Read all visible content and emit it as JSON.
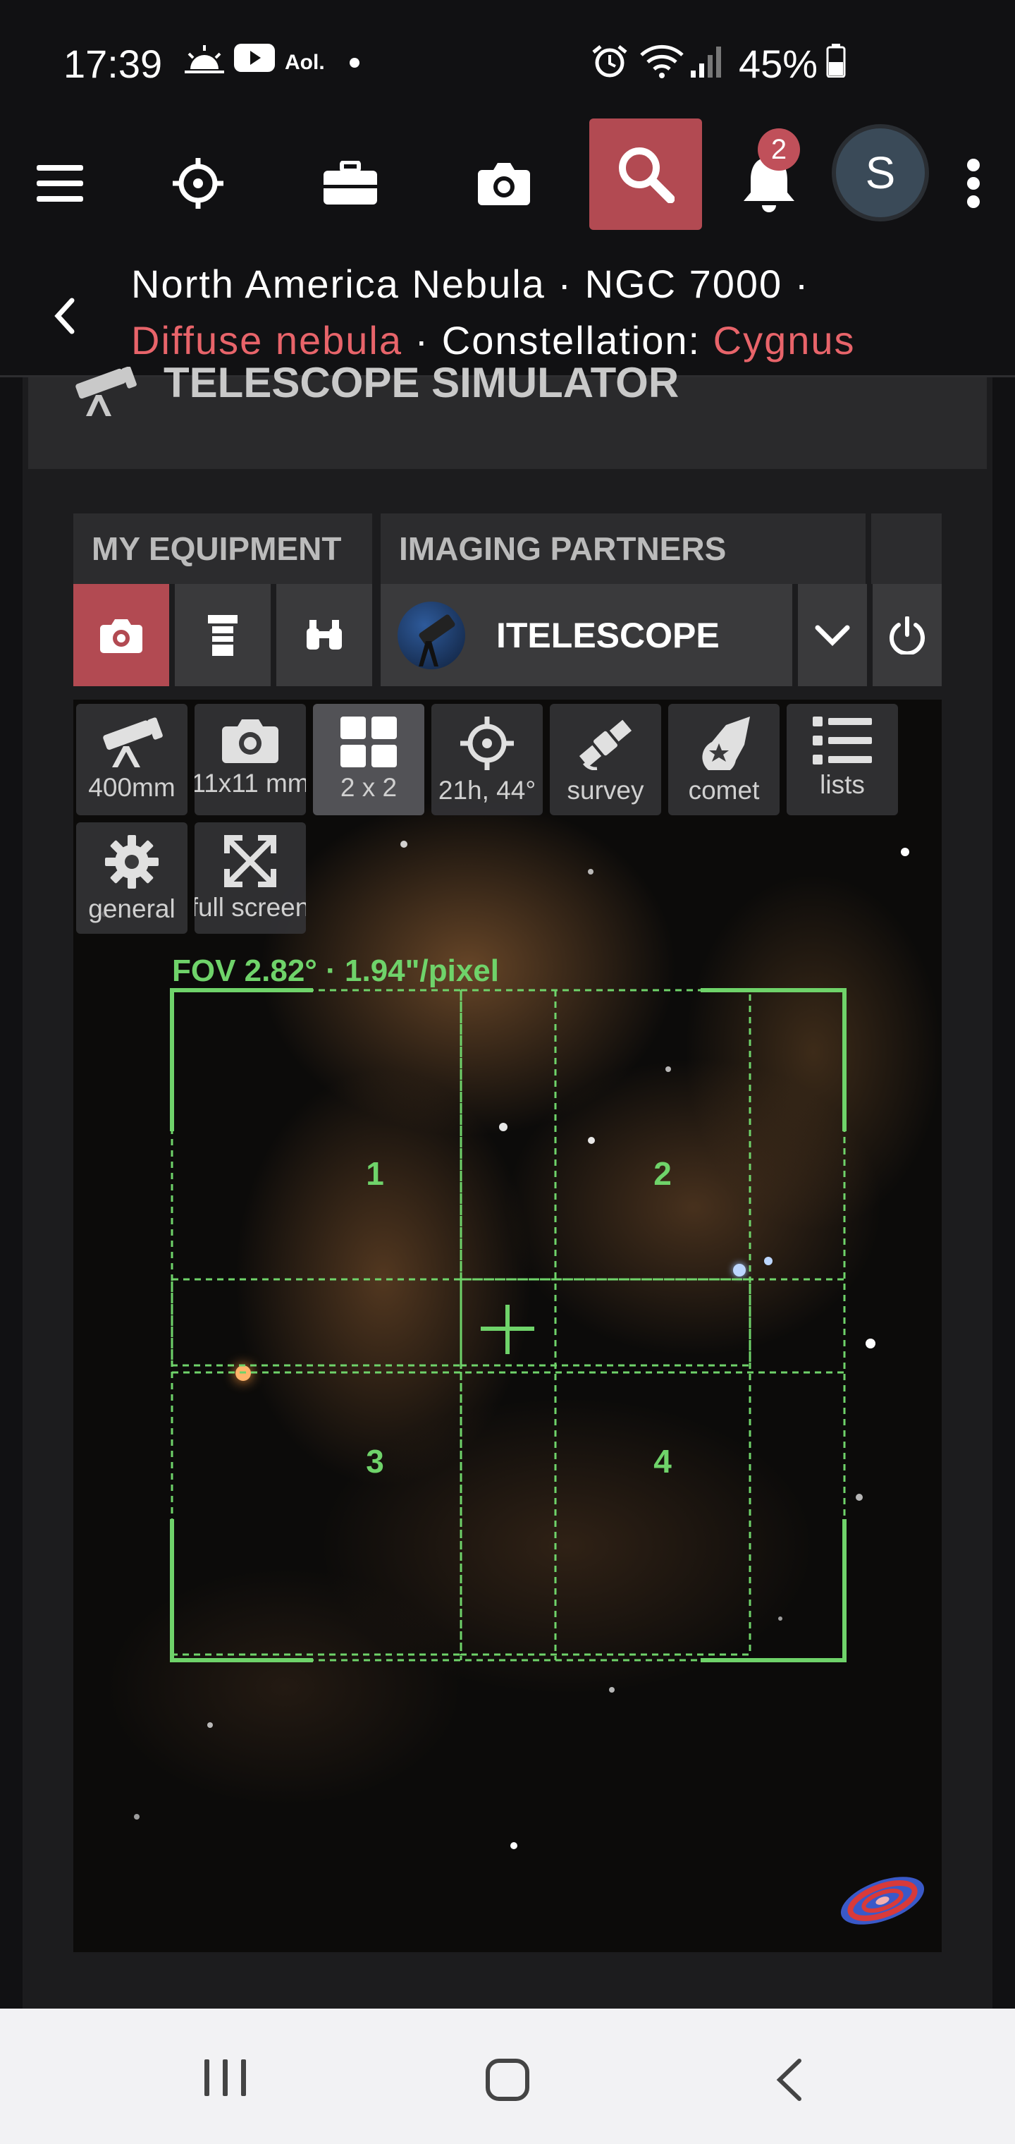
{
  "status_bar": {
    "time": "17:39",
    "aol_label": "Aol.",
    "battery": "45%"
  },
  "nav": {
    "notification_count": "2",
    "avatar_initial": "S"
  },
  "title": {
    "name": "North America Nebula",
    "sep1": " · ",
    "catalog": "NGC 7000",
    "sep2": " ·",
    "type": "Diffuse nebula",
    "constellation_prefix": " · Constellation: ",
    "constellation": "Cygnus"
  },
  "panel": {
    "title": "TELESCOPE SIMULATOR"
  },
  "tabs": {
    "my_equipment": "MY EQUIPMENT",
    "imaging_partners": "IMAGING PARTNERS"
  },
  "partner": {
    "name": "ITELESCOPE"
  },
  "sim_buttons": [
    {
      "label": "400mm",
      "icon": "telescope-icon"
    },
    {
      "label": "11x11 mm",
      "icon": "camera-icon"
    },
    {
      "label": "2 x 2",
      "icon": "mosaic-grid-icon"
    },
    {
      "label": "21h, 44°",
      "icon": "crosshair-icon"
    },
    {
      "label": "survey",
      "icon": "satellite-icon"
    },
    {
      "label": "comet",
      "icon": "comet-icon"
    },
    {
      "label": "lists",
      "icon": "list-icon"
    },
    {
      "label": "general",
      "icon": "gear-icon"
    },
    {
      "label": "full screen",
      "icon": "fullscreen-icon"
    }
  ],
  "fov": {
    "label": "FOV 2.82° · 1.94\"/pixel"
  },
  "mosaic": {
    "panels": [
      "1",
      "2",
      "3",
      "4"
    ]
  },
  "colors": {
    "accent": "#b24a52",
    "highlight_text": "#e8646a",
    "fov_green": "#6fd36a"
  }
}
